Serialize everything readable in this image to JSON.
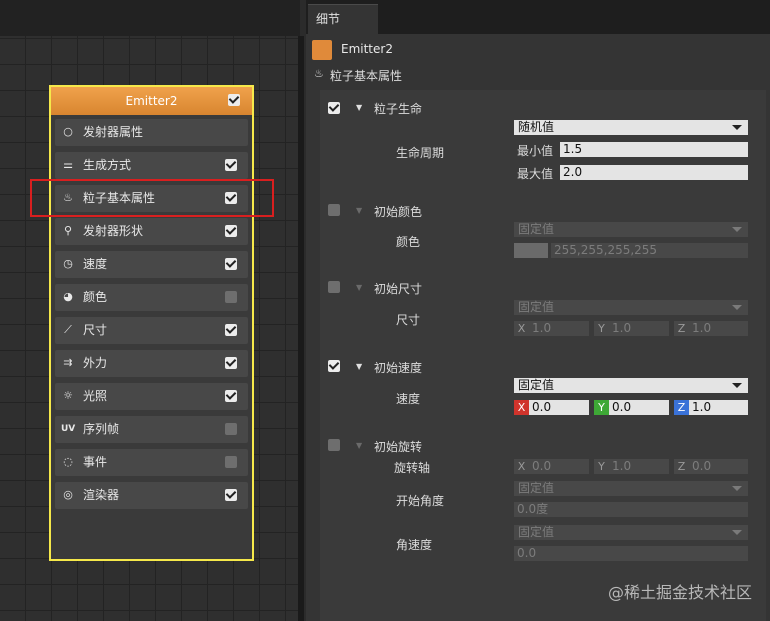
{
  "graph": {
    "node": {
      "title": "Emitter2",
      "enabled": true,
      "items": [
        {
          "label": "发射器属性",
          "icon": "circle-icon",
          "glyph": "○",
          "checked": null
        },
        {
          "label": "生成方式",
          "icon": "sliders-icon",
          "glyph": "⚌",
          "checked": true
        },
        {
          "label": "粒子基本属性",
          "icon": "flame-icon",
          "glyph": "♨",
          "checked": true
        },
        {
          "label": "发射器形状",
          "icon": "location-pin-icon",
          "glyph": "⚲",
          "checked": true
        },
        {
          "label": "速度",
          "icon": "speedometer-icon",
          "glyph": "◷",
          "checked": true
        },
        {
          "label": "颜色",
          "icon": "palette-icon",
          "glyph": "◕",
          "checked": false
        },
        {
          "label": "尺寸",
          "icon": "ruler-icon",
          "glyph": "⟋",
          "checked": true
        },
        {
          "label": "外力",
          "icon": "force-arrows-icon",
          "glyph": "⇉",
          "checked": true
        },
        {
          "label": "光照",
          "icon": "sun-icon",
          "glyph": "☼",
          "checked": true
        },
        {
          "label": "序列帧",
          "icon": "uv-icon",
          "glyph": "UV",
          "checked": false
        },
        {
          "label": "事件",
          "icon": "refresh-icon",
          "glyph": "◌",
          "checked": false
        },
        {
          "label": "渲染器",
          "icon": "render-icon",
          "glyph": "◎",
          "checked": true
        }
      ]
    }
  },
  "details": {
    "tab": "细节",
    "emitter_name": "Emitter2",
    "section_title": "粒子基本属性",
    "groups": {
      "life": {
        "title": "粒子生命",
        "enabled": true,
        "prop_label": "生命周期",
        "mode": "随机值",
        "min_label": "最小值",
        "min_value": "1.5",
        "max_label": "最大值",
        "max_value": "2.0"
      },
      "color": {
        "title": "初始颜色",
        "enabled": false,
        "prop_label": "颜色",
        "mode": "固定值",
        "value": "255,255,255,255"
      },
      "size": {
        "title": "初始尺寸",
        "enabled": false,
        "prop_label": "尺寸",
        "mode": "固定值",
        "x": "1.0",
        "y": "1.0",
        "z": "1.0"
      },
      "velocity": {
        "title": "初始速度",
        "enabled": true,
        "prop_label": "速度",
        "mode": "固定值",
        "x": "0.0",
        "y": "0.0",
        "z": "1.0"
      },
      "rotation": {
        "title": "初始旋转",
        "enabled": false,
        "axis_label": "旋转轴",
        "x": "0.0",
        "y": "1.0",
        "z": "0.0",
        "start_label": "开始角度",
        "start_mode": "固定值",
        "start_value": "0.0度",
        "speed_label": "角速度",
        "speed_mode": "固定值",
        "speed_value": "0.0"
      }
    },
    "axis_labels": {
      "x": "X",
      "y": "Y",
      "z": "Z"
    }
  },
  "watermark": "@稀土掘金技术社区"
}
